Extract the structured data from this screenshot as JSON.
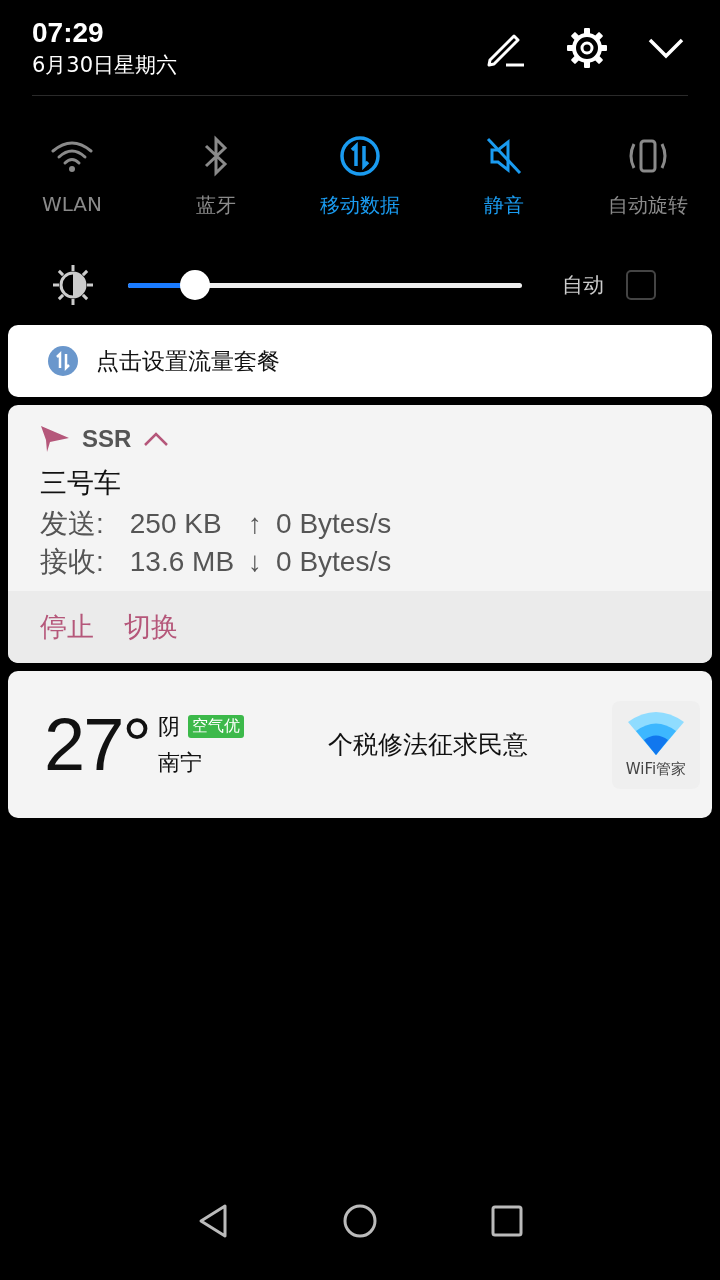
{
  "header": {
    "time": "07:29",
    "date": "6月30日星期六"
  },
  "toggles": [
    {
      "kind": "wifi",
      "label": "WLAN",
      "on": false
    },
    {
      "kind": "bluetooth",
      "label": "蓝牙",
      "on": false
    },
    {
      "kind": "data",
      "label": "移动数据",
      "on": true
    },
    {
      "kind": "mute",
      "label": "静音",
      "on": true
    },
    {
      "kind": "rotate",
      "label": "自动旋转",
      "on": false
    }
  ],
  "brightness": {
    "level": 0.17,
    "auto_label": "自动",
    "auto_checked": false
  },
  "data_plan_notification": {
    "text": "点击设置流量套餐"
  },
  "ssr_notification": {
    "app": "SSR",
    "expanded": true,
    "title": "三号车",
    "rows": [
      {
        "label": "发送:",
        "amount": "250 KB",
        "arrow": "↑",
        "speed": "0 Bytes/s"
      },
      {
        "label": "接收:",
        "amount": "13.6 MB",
        "arrow": "↓",
        "speed": "0 Bytes/s"
      }
    ],
    "actions": [
      "停止",
      "切换"
    ]
  },
  "weather_card": {
    "temperature": "27°",
    "condition": "阴",
    "air_quality": "空气优",
    "city": "南宁",
    "headline": "个税修法征求民意",
    "app_label": "WiFi管家"
  }
}
